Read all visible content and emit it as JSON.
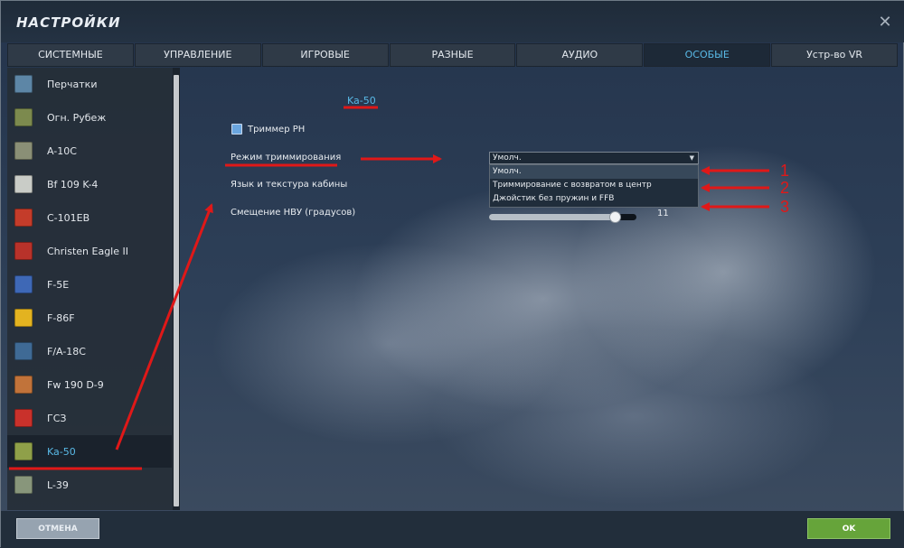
{
  "window": {
    "title": "НАСТРОЙКИ",
    "close_glyph": "✕"
  },
  "tabs": [
    {
      "label": "СИСТЕМНЫЕ",
      "active": false
    },
    {
      "label": "УПРАВЛЕНИЕ",
      "active": false
    },
    {
      "label": "ИГРОВЫЕ",
      "active": false
    },
    {
      "label": "РАЗНЫЕ",
      "active": false
    },
    {
      "label": "АУДИО",
      "active": false
    },
    {
      "label": "ОСОБЫЕ",
      "active": true
    },
    {
      "label": "Устр-во VR",
      "active": false
    }
  ],
  "sidebar": {
    "items": [
      {
        "label": "Перчатки",
        "icon": "gloves-icon",
        "color": "#5d86a6"
      },
      {
        "label": "Огн. Рубеж",
        "icon": "firing-line-icon",
        "color": "#7c8a4e"
      },
      {
        "label": "A-10C",
        "icon": "a10c-icon",
        "color": "#8a8f76"
      },
      {
        "label": "Bf 109 K-4",
        "icon": "bf109-icon",
        "color": "#c9ccc7"
      },
      {
        "label": "C-101EB",
        "icon": "c101-icon",
        "color": "#c43c2a"
      },
      {
        "label": "Christen Eagle II",
        "icon": "christen-eagle-icon",
        "color": "#b8322a"
      },
      {
        "label": "F-5E",
        "icon": "f5e-icon",
        "color": "#3e68b6"
      },
      {
        "label": "F-86F",
        "icon": "f86f-icon",
        "color": "#e3b320"
      },
      {
        "label": "F/A-18C",
        "icon": "fa18c-icon",
        "color": "#3f6a95"
      },
      {
        "label": "Fw 190 D-9",
        "icon": "fw190-icon",
        "color": "#c1733a"
      },
      {
        "label": "ГСЗ",
        "icon": "star-icon",
        "color": "#c9312b"
      },
      {
        "label": "Ka-50",
        "icon": "ka50-icon",
        "color": "#8fa049",
        "active": true
      },
      {
        "label": "L-39",
        "icon": "l39-icon",
        "color": "#88967b"
      }
    ]
  },
  "main": {
    "section_title": "Ka-50",
    "trimmer_label": "Триммер РН",
    "trim_mode_label": "Режим триммирования",
    "cockpit_lang_label": "Язык и текстура кабины",
    "hmd_offset_label": "Смещение НВУ (градусов)",
    "dropdown": {
      "value": "Умолч.",
      "options": [
        "Умолч.",
        "Триммирование с возвратом в центр",
        "Джойстик без пружин и FFB"
      ]
    },
    "slider": {
      "value": "11",
      "fraction": 0.85
    }
  },
  "annotations": {
    "numbers": [
      "1",
      "2",
      "3"
    ],
    "color": "#e01818"
  },
  "footer": {
    "cancel_label": "ОТМЕНА",
    "ok_label": "OK"
  }
}
